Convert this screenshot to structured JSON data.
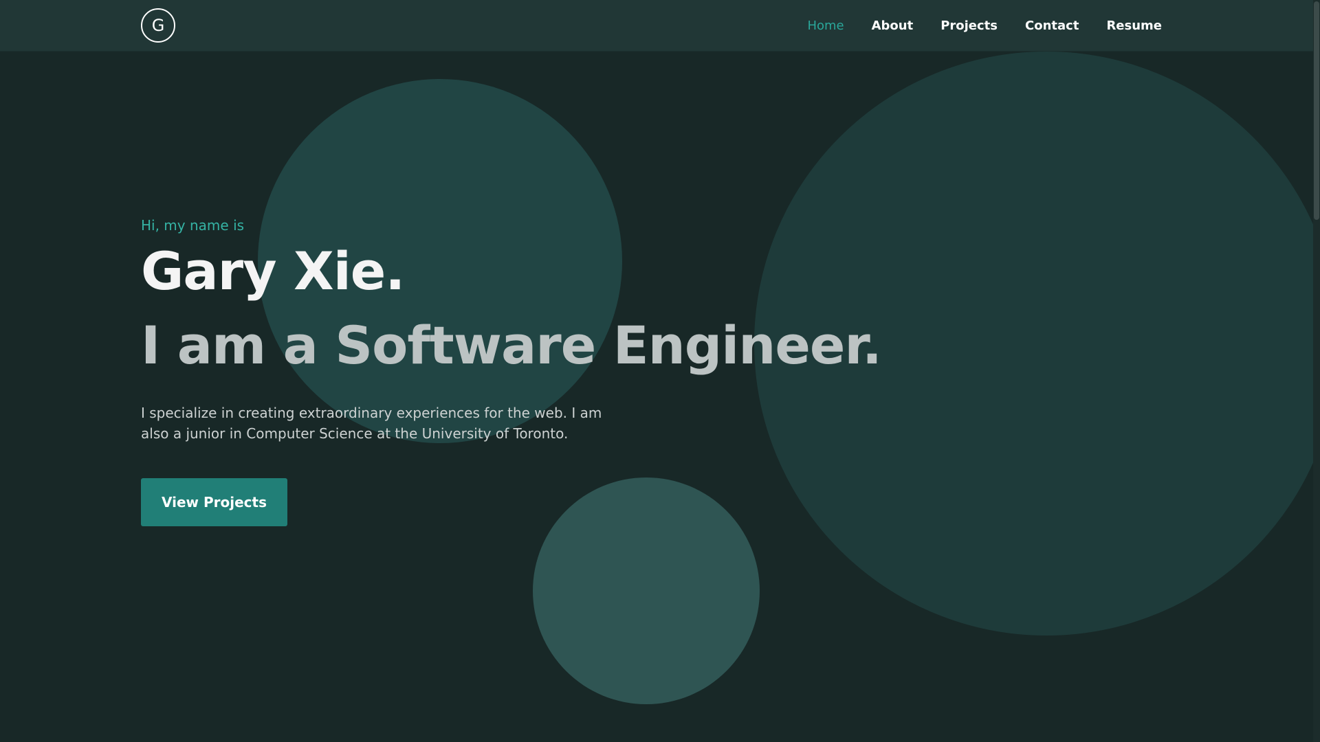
{
  "nav": {
    "logo_letter": "G",
    "links": [
      {
        "label": "Home",
        "active": true
      },
      {
        "label": "About",
        "active": false
      },
      {
        "label": "Projects",
        "active": false
      },
      {
        "label": "Contact",
        "active": false
      },
      {
        "label": "Resume",
        "active": false
      }
    ]
  },
  "hero": {
    "greeting": "Hi, my name is",
    "name": "Gary Xie.",
    "tagline": "I am a Software Engineer.",
    "description": "I specialize in creating extraordinary experiences for the web. I am also a junior in Computer Science at the University of Toronto.",
    "cta_label": "View Projects"
  },
  "colors": {
    "background": "#182827",
    "navbar": "#213736",
    "accent": "#2aa79a",
    "button": "#217f77",
    "circle_top": "#214544",
    "circle_big": "#1e3b3a",
    "circle_small": "#2f5553"
  }
}
